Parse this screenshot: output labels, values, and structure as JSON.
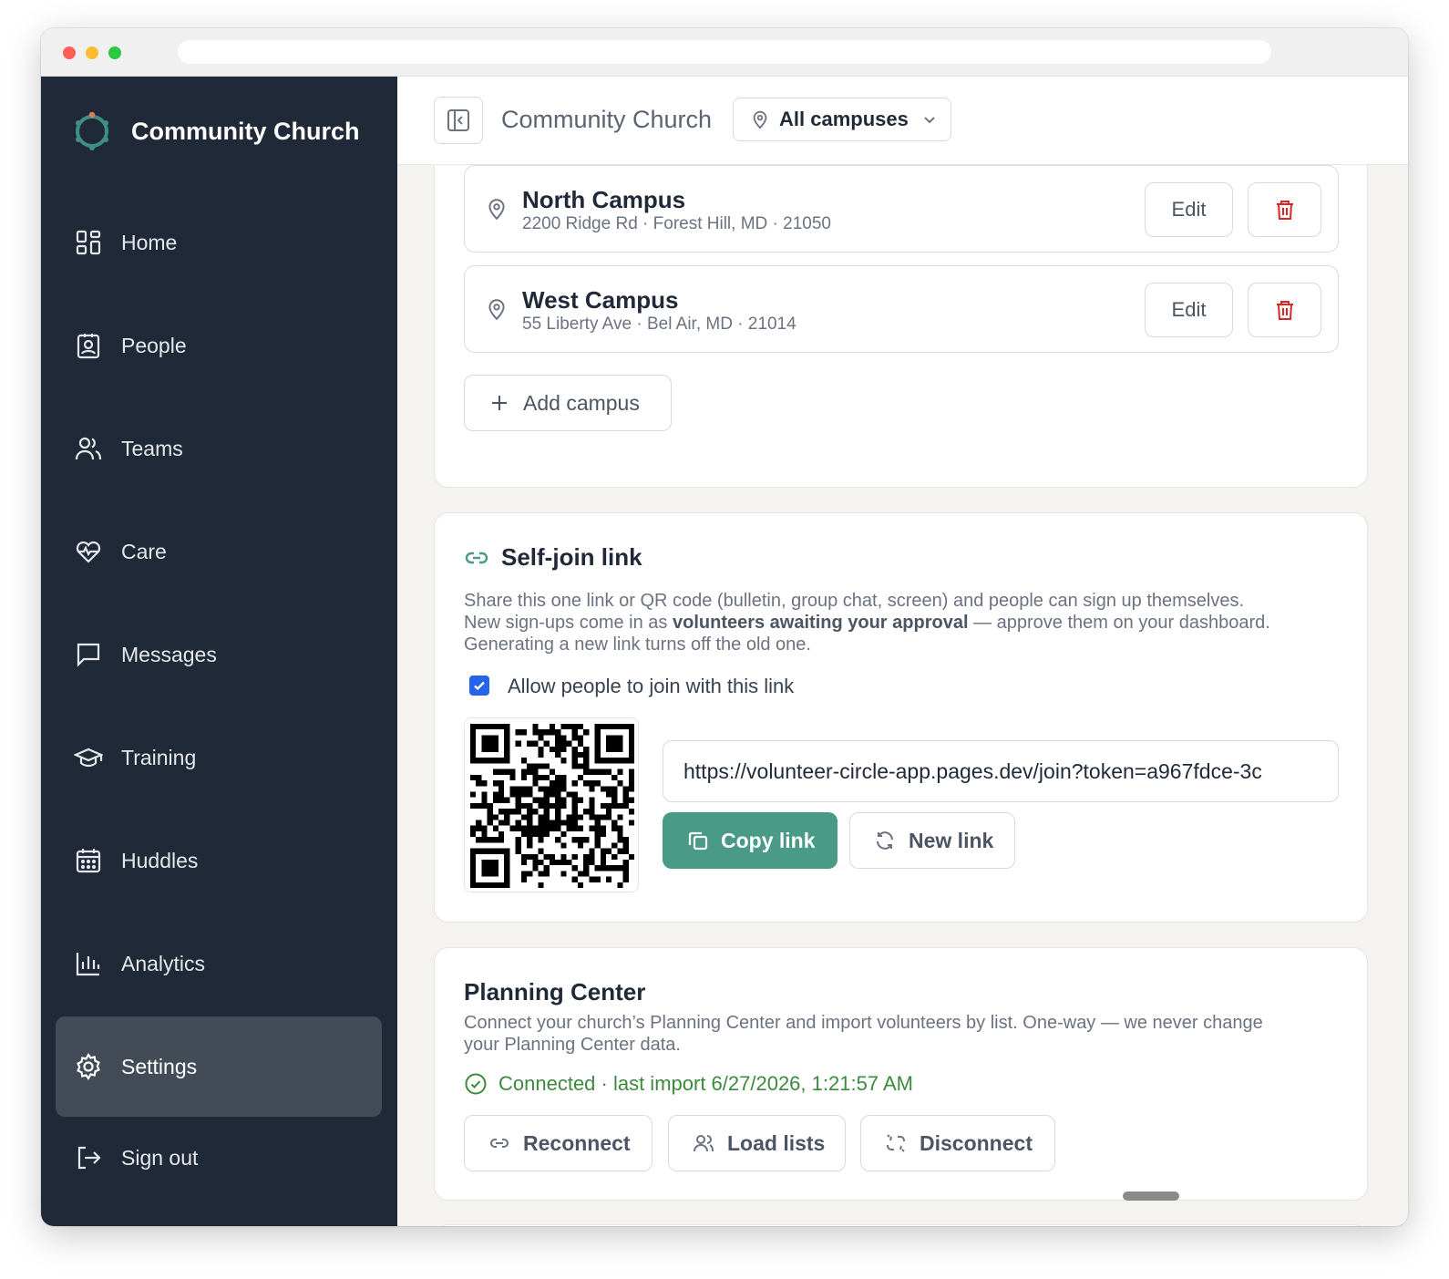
{
  "brand": {
    "name": "Community Church"
  },
  "sidebar": {
    "items": [
      {
        "label": "Home",
        "icon": "home-icon"
      },
      {
        "label": "People",
        "icon": "people-icon"
      },
      {
        "label": "Teams",
        "icon": "teams-icon"
      },
      {
        "label": "Care",
        "icon": "care-icon"
      },
      {
        "label": "Messages",
        "icon": "messages-icon"
      },
      {
        "label": "Training",
        "icon": "training-icon"
      },
      {
        "label": "Huddles",
        "icon": "huddles-icon"
      },
      {
        "label": "Analytics",
        "icon": "analytics-icon"
      },
      {
        "label": "Settings",
        "icon": "settings-icon",
        "active": true
      },
      {
        "label": "Sign out",
        "icon": "sign-out-icon"
      }
    ]
  },
  "header": {
    "title": "Community Church",
    "campus_select": "All campuses"
  },
  "campuses": {
    "items": [
      {
        "name": "North Campus",
        "address": "2200 Ridge Rd · Forest Hill, MD · 21050",
        "edit_label": "Edit"
      },
      {
        "name": "West Campus",
        "address": "55 Liberty Ave · Bel Air, MD · 21014",
        "edit_label": "Edit"
      }
    ],
    "add_label": "Add campus"
  },
  "self_join": {
    "title": "Self-join link",
    "desc_line1": "Share this one link or QR code (bulletin, group chat, screen) and people can sign up themselves.",
    "desc_line2_pre": "New sign-ups come in as ",
    "desc_line2_bold": "volunteers awaiting your approval",
    "desc_line2_post": " — approve them on your dashboard.",
    "desc_line3": "Generating a new link turns off the old one.",
    "checkbox_label": "Allow people to join with this link",
    "checkbox_checked": true,
    "link": "https://volunteer-circle-app.pages.dev/join?token=a967fdce-3c",
    "copy_label": "Copy link",
    "new_label": "New link"
  },
  "planning_center": {
    "title": "Planning Center",
    "desc_line1": "Connect your church’s Planning Center and import volunteers by list. One-way — we never change",
    "desc_line2": "your Planning Center data.",
    "status": "Connected · last import 6/27/2026, 1:21:57 AM",
    "reconnect_label": "Reconnect",
    "load_lists_label": "Load lists",
    "disconnect_label": "Disconnect"
  },
  "colors": {
    "sidebar_bg": "#1f2937",
    "accent": "#4a9a88",
    "danger": "#dc2626",
    "success": "#3b8a3e",
    "checkbox": "#2563eb"
  }
}
